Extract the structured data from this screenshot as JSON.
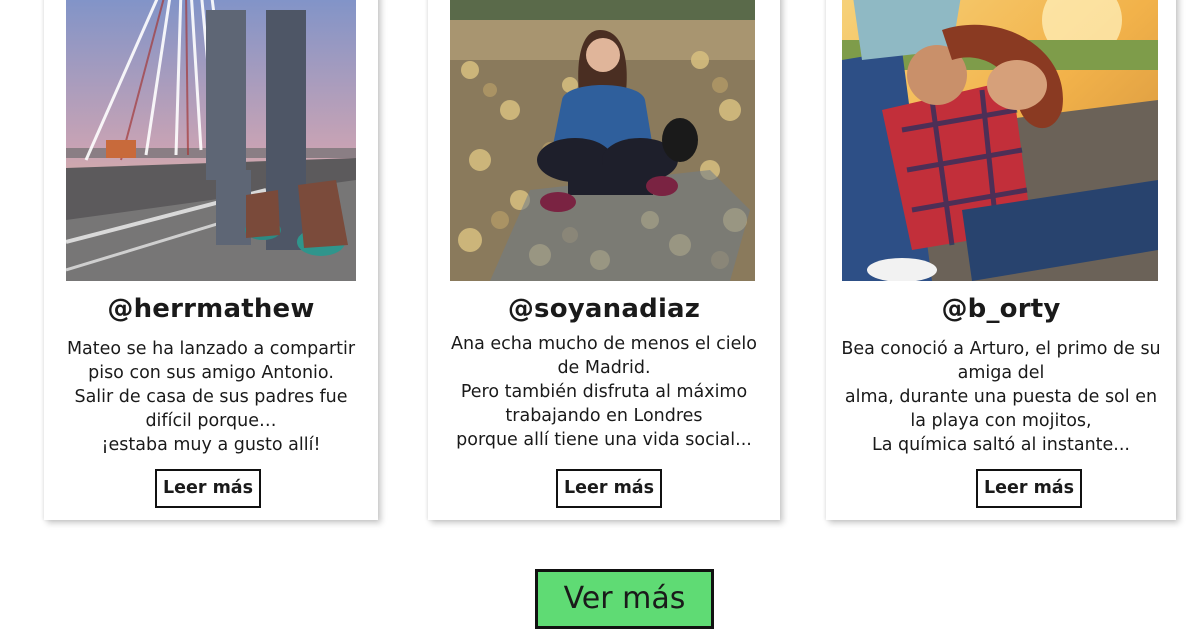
{
  "cards": [
    {
      "handle": "@herrmathew",
      "bio_lines": [
        "Mateo se ha lanzado a compartir",
        "piso con sus amigo Antonio.",
        "Salir de casa de sus padres fue",
        "difícil porque…",
        "¡estaba muy a gusto allí!"
      ],
      "button_label": "Leer más"
    },
    {
      "handle": "@soyanadiaz",
      "bio_lines": [
        "Ana echa mucho de menos el cielo",
        "de Madrid.",
        "Pero también disfruta al máximo",
        "trabajando en Londres",
        "porque allí tiene una vida social..."
      ],
      "button_label": "Leer más"
    },
    {
      "handle": "@b_orty",
      "bio_lines": [
        "Bea conoció a Arturo, el primo de su",
        "amiga del",
        "alma, durante una puesta de sol en",
        "la playa con mojitos,",
        "La química saltó al instante..."
      ],
      "button_label": "Leer más"
    }
  ],
  "more_button": {
    "label": "Ver más",
    "color": "#5fdb74"
  }
}
